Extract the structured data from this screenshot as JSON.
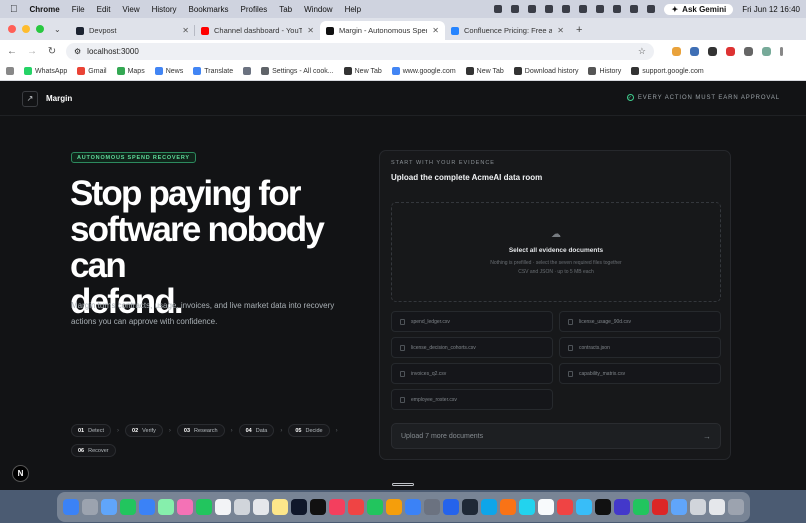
{
  "menubar": {
    "app": "Chrome",
    "items": [
      "File",
      "Edit",
      "View",
      "History",
      "Bookmarks",
      "Profiles",
      "Tab",
      "Window",
      "Help"
    ],
    "ask_gemini": "Ask Gemini",
    "datetime": "Fri Jun 12  16:40"
  },
  "tabs": [
    {
      "title": "Devpost",
      "favicon_color": "#1c2331"
    },
    {
      "title": "Channel dashboard - YouTube",
      "favicon_color": "#ff0000"
    },
    {
      "title": "Margin - Autonomous Spend",
      "favicon_color": "#111111"
    },
    {
      "title": "Confluence Pricing: Free and",
      "favicon_color": "#2684ff"
    }
  ],
  "address": {
    "url": "localhost:3000"
  },
  "bookmarks": [
    {
      "label": "WhatsApp",
      "color": "#25d366"
    },
    {
      "label": "Gmail",
      "color": "#ea4335"
    },
    {
      "label": "Maps",
      "color": "#34a853"
    },
    {
      "label": "News",
      "color": "#4285f4"
    },
    {
      "label": "Translate",
      "color": "#4285f4"
    },
    {
      "label": "",
      "color": "#6b7280"
    },
    {
      "label": "Settings - All cook...",
      "color": "#5f6368"
    },
    {
      "label": "New Tab",
      "color": "#333333"
    },
    {
      "label": "www.google.com",
      "color": "#4285f4"
    },
    {
      "label": "New Tab",
      "color": "#333333"
    },
    {
      "label": "Download history",
      "color": "#333333"
    },
    {
      "label": "History",
      "color": "#555555"
    },
    {
      "label": "support.google.com",
      "color": "#333333"
    }
  ],
  "app": {
    "brand": "Margin",
    "approval_note": "EVERY ACTION MUST EARN APPROVAL",
    "badge": "AUTONOMOUS SPEND RECOVERY",
    "hero_lines": [
      "Stop paying for",
      "software nobody can",
      "defend."
    ],
    "subtitle": "Margin turns contracts, usage, invoices, and live market data into recovery actions you can approve with confidence.",
    "steps": [
      {
        "num": "01",
        "label": "Detect"
      },
      {
        "num": "02",
        "label": "Verify"
      },
      {
        "num": "03",
        "label": "Research"
      },
      {
        "num": "04",
        "label": "Data"
      },
      {
        "num": "05",
        "label": "Decide"
      },
      {
        "num": "06",
        "label": "Recover"
      }
    ],
    "card": {
      "kicker": "START WITH YOUR EVIDENCE",
      "title": "Upload the complete AcmeAI data room",
      "drop_title": "Select all evidence documents",
      "drop_hint": "Nothing is prefilled · select the seven required files together",
      "drop_limits": "CSV and JSON · up to 5 MB each",
      "files": [
        "spend_ledger.csv",
        "license_usage_90d.csv",
        "license_decision_cohorts.csv",
        "contracts.json",
        "invoices_q2.csv",
        "capability_matrix.csv",
        "employee_roster.csv"
      ],
      "upload_button": "Upload 7 more documents"
    }
  },
  "colors": {
    "accent_green": "#3fcf8e",
    "page_bg": "#121315"
  }
}
